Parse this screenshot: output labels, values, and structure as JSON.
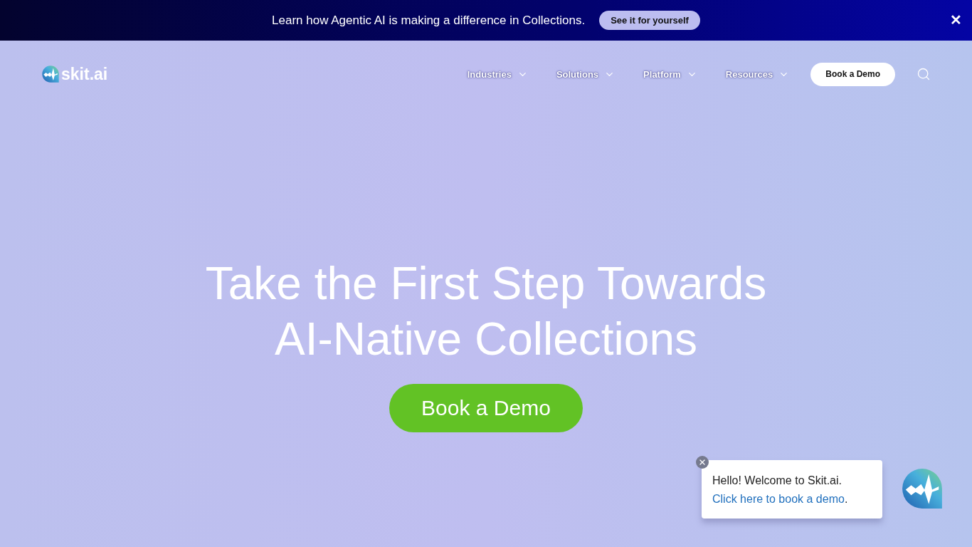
{
  "announcement": {
    "text": "Learn how Agentic AI is making a difference in Collections.",
    "button": "See it for yourself",
    "close": "✕"
  },
  "nav": {
    "logo": "skit.ai",
    "items": [
      {
        "label": "Industries"
      },
      {
        "label": "Solutions"
      },
      {
        "label": "Platform"
      },
      {
        "label": "Resources"
      }
    ],
    "cta": "Book a Demo"
  },
  "hero": {
    "title_lines": [
      "Take the First Step Towards",
      "AI-Native Collections"
    ],
    "button": "Book a Demo"
  },
  "chat": {
    "greeting": "Hello! Welcome to Skit.ai.",
    "link": "Click here to book a demo",
    "end": "."
  }
}
